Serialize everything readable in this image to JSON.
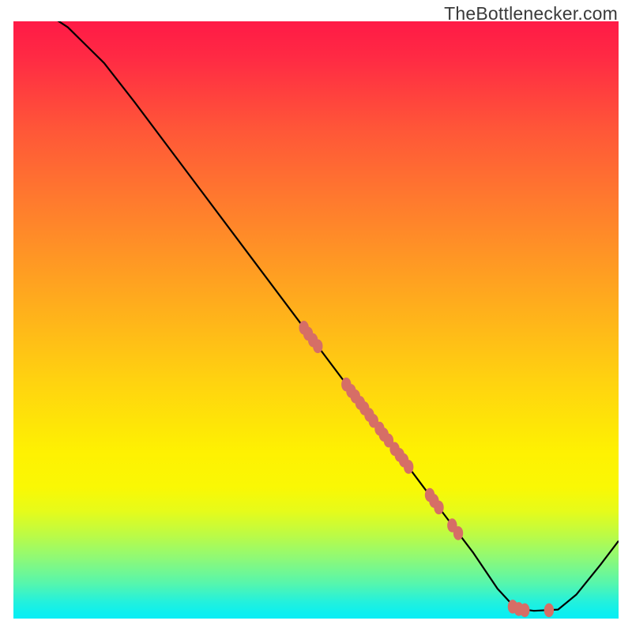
{
  "attribution": "TheBottlenecker.com",
  "chart_data": {
    "type": "line",
    "title": "",
    "xlabel": "",
    "ylabel": "",
    "xlim": [
      0,
      100
    ],
    "ylim": [
      0,
      100
    ],
    "curve_description": "Bottleneck curve: high at left, descending to a wide minimum near x≈83–90, then rising at right",
    "curve_points": [
      {
        "x": 0.0,
        "y": 103.0
      },
      {
        "x": 3.0,
        "y": 102.0
      },
      {
        "x": 6.0,
        "y": 101.0
      },
      {
        "x": 9.0,
        "y": 99.0
      },
      {
        "x": 12.0,
        "y": 96.0
      },
      {
        "x": 15.0,
        "y": 93.0
      },
      {
        "x": 20.0,
        "y": 86.5
      },
      {
        "x": 30.0,
        "y": 73.0
      },
      {
        "x": 40.0,
        "y": 59.5
      },
      {
        "x": 50.0,
        "y": 46.0
      },
      {
        "x": 60.0,
        "y": 32.5
      },
      {
        "x": 70.0,
        "y": 19.0
      },
      {
        "x": 76.0,
        "y": 11.0
      },
      {
        "x": 80.0,
        "y": 5.0
      },
      {
        "x": 83.0,
        "y": 1.7
      },
      {
        "x": 86.0,
        "y": 1.3
      },
      {
        "x": 90.0,
        "y": 1.5
      },
      {
        "x": 93.0,
        "y": 4.0
      },
      {
        "x": 97.0,
        "y": 9.0
      },
      {
        "x": 100.0,
        "y": 13.0
      }
    ],
    "series": [
      {
        "name": "data-markers",
        "style": "scatter",
        "color": "#d66e66",
        "points": [
          {
            "x": 48.0,
            "y": 48.7
          },
          {
            "x": 48.7,
            "y": 47.7
          },
          {
            "x": 49.5,
            "y": 46.6
          },
          {
            "x": 50.3,
            "y": 45.6
          },
          {
            "x": 55.0,
            "y": 39.2
          },
          {
            "x": 55.8,
            "y": 38.1
          },
          {
            "x": 56.5,
            "y": 37.2
          },
          {
            "x": 57.3,
            "y": 36.1
          },
          {
            "x": 58.0,
            "y": 35.2
          },
          {
            "x": 58.8,
            "y": 34.1
          },
          {
            "x": 59.5,
            "y": 33.1
          },
          {
            "x": 60.5,
            "y": 31.8
          },
          {
            "x": 61.2,
            "y": 30.8
          },
          {
            "x": 62.0,
            "y": 29.8
          },
          {
            "x": 63.0,
            "y": 28.4
          },
          {
            "x": 63.8,
            "y": 27.4
          },
          {
            "x": 64.5,
            "y": 26.5
          },
          {
            "x": 65.3,
            "y": 25.4
          },
          {
            "x": 68.8,
            "y": 20.7
          },
          {
            "x": 69.5,
            "y": 19.7
          },
          {
            "x": 70.3,
            "y": 18.6
          },
          {
            "x": 72.5,
            "y": 15.6
          },
          {
            "x": 73.5,
            "y": 14.3
          },
          {
            "x": 82.5,
            "y": 2.0
          },
          {
            "x": 83.5,
            "y": 1.6
          },
          {
            "x": 84.5,
            "y": 1.4
          },
          {
            "x": 88.5,
            "y": 1.4
          }
        ]
      }
    ]
  }
}
